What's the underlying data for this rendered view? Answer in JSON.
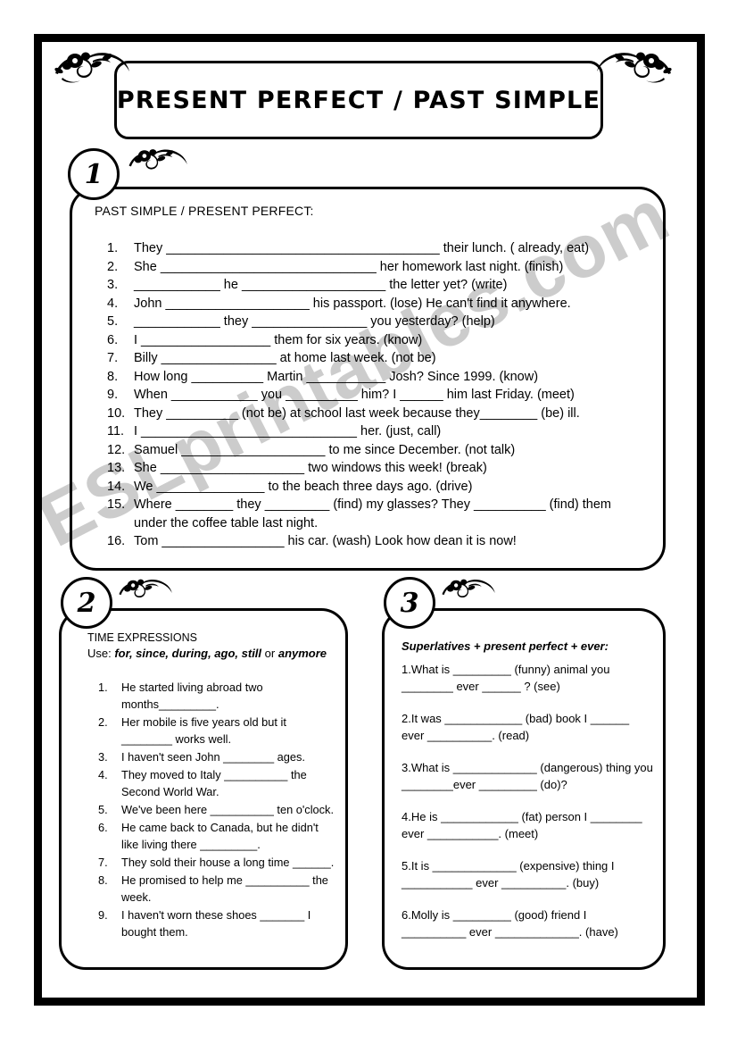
{
  "watermark": {
    "text": "ESLprintables.com"
  },
  "title": {
    "text": "PRESENT PERFECT / PAST SIMPLE"
  },
  "sections": [
    {
      "number": "1",
      "heading": "PAST SIMPLE / PRESENT PERFECT:",
      "items": [
        {
          "index": "1.",
          "text": "They ______________________________________ their lunch. ( already, eat)"
        },
        {
          "index": "2.",
          "text": "She ______________________________ her homework last night. (finish)"
        },
        {
          "index": "3.",
          "text": "____________ he ____________________ the letter yet? (write)"
        },
        {
          "index": "4.",
          "text": "John ____________________ his passport. (lose) He can't find it anywhere."
        },
        {
          "index": "5.",
          "text": "____________ they ________________ you yesterday? (help)"
        },
        {
          "index": "6.",
          "text": "I __________________ them for six years. (know)"
        },
        {
          "index": "7.",
          "text": "Billy ________________ at home last week. (not be)"
        },
        {
          "index": "8.",
          "text": "How long __________ Martin ___________ Josh? Since 1999. (know)"
        },
        {
          "index": "9.",
          "text": "When ____________ you __________ him? I ______ him last Friday. (meet)"
        },
        {
          "index": "10.",
          "text": "They __________ (not be) at school last week because they________ (be) ill."
        },
        {
          "index": "11.",
          "text": "I ______________________________ her. (just, call)"
        },
        {
          "index": "12.",
          "text": "Samuel ____________________ to me since December. (not talk)"
        },
        {
          "index": "13.",
          "text": "She ____________________ two windows this week! (break)"
        },
        {
          "index": "14.",
          "text": "We _______________ to the beach three days ago. (drive)"
        },
        {
          "index": "15.",
          "text": "Where ________ they _________ (find) my glasses? They __________ (find) them",
          "continuation": "under the coffee table last night."
        },
        {
          "index": "16.",
          "text": "Tom _________________ his car. (wash) Look how dean it is now!"
        }
      ]
    },
    {
      "number": "2",
      "heading": "TIME EXPRESSIONS",
      "use_prefix": "Use: ",
      "use_words": "for, since, during, ago, still",
      "use_conjunction": " or ",
      "use_last": "anymore",
      "items": [
        {
          "index": "1.",
          "text": "He started living abroad two months_________."
        },
        {
          "index": "2.",
          "text": "Her mobile is five years old but it ________ works well."
        },
        {
          "index": "3.",
          "text": "I haven't seen John ________ ages."
        },
        {
          "index": "4.",
          "text": "They moved to Italy __________ the Second World War."
        },
        {
          "index": "5.",
          "text": "We've been here __________ ten o'clock."
        },
        {
          "index": "6.",
          "text": "He came back to Canada, but he didn't like living there _________."
        },
        {
          "index": "7.",
          "text": "They sold their house a long time ______."
        },
        {
          "index": "8.",
          "text": "He promised to help me __________ the week."
        },
        {
          "index": "9.",
          "text": "I haven't  worn these shoes _______ I bought them."
        }
      ]
    },
    {
      "number": "3",
      "heading": "Superlatives + present perfect +  ever:",
      "items": [
        {
          "index": "1.",
          "text": "What is _________ (funny) animal you ________ ever ______ ? (see)"
        },
        {
          "index": "2.",
          "text": "It was ____________ (bad) book  I ______ ever __________. (read)"
        },
        {
          "index": "3.",
          "text": "What is _____________  (dangerous) thing you ________ever _________ (do)?"
        },
        {
          "index": "4.",
          "text": "He is ____________ (fat) person I ________ ever ___________. (meet)"
        },
        {
          "index": "5.",
          "text": "It is _____________ (expensive) thing I ___________ ever __________. (buy)"
        },
        {
          "index": "6.",
          "text": "Molly is _________ (good) friend I __________ ever _____________. (have)"
        }
      ]
    }
  ]
}
